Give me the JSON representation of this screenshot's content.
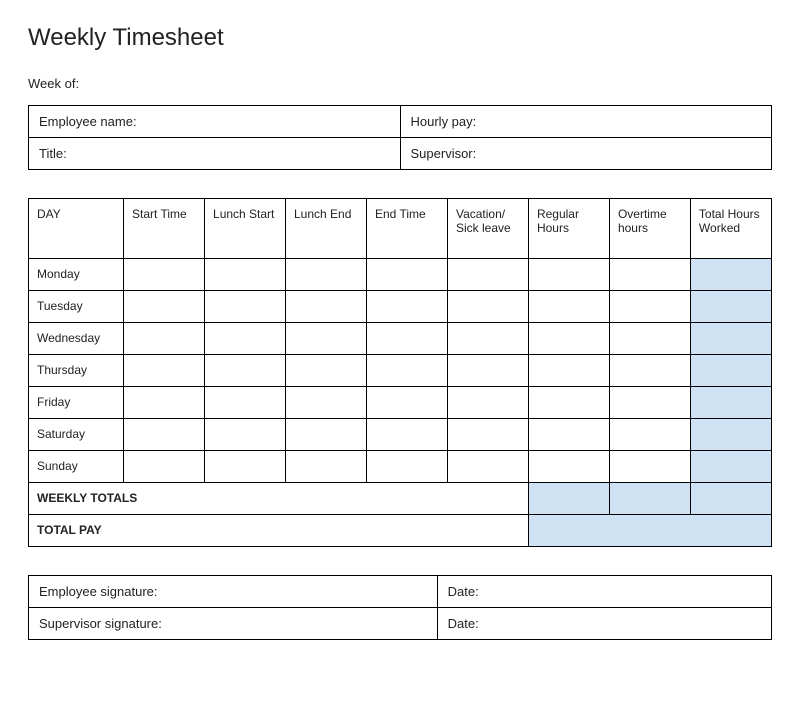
{
  "title": "Weekly Timesheet",
  "week_of_label": "Week of:",
  "info": {
    "employee_name_label": "Employee name:",
    "hourly_pay_label": "Hourly pay:",
    "title_label": "Title:",
    "supervisor_label": "Supervisor:"
  },
  "headers": {
    "day": "DAY",
    "start_time": "Start Time",
    "lunch_start": "Lunch Start",
    "lunch_end": "Lunch End",
    "end_time": "End Time",
    "vacation_sick": "Vacation/ Sick leave",
    "regular_hours": "Regular Hours",
    "overtime_hours": "Overtime hours",
    "total_hours": "Total Hours Worked"
  },
  "days": {
    "mon": "Monday",
    "tue": "Tuesday",
    "wed": "Wednesday",
    "thu": "Thursday",
    "fri": "Friday",
    "sat": "Saturday",
    "sun": "Sunday"
  },
  "totals": {
    "weekly_totals_label": "WEEKLY TOTALS",
    "total_pay_label": "TOTAL PAY"
  },
  "signatures": {
    "employee_sig_label": "Employee signature:",
    "supervisor_sig_label": "Supervisor signature:",
    "date_label": "Date:"
  }
}
